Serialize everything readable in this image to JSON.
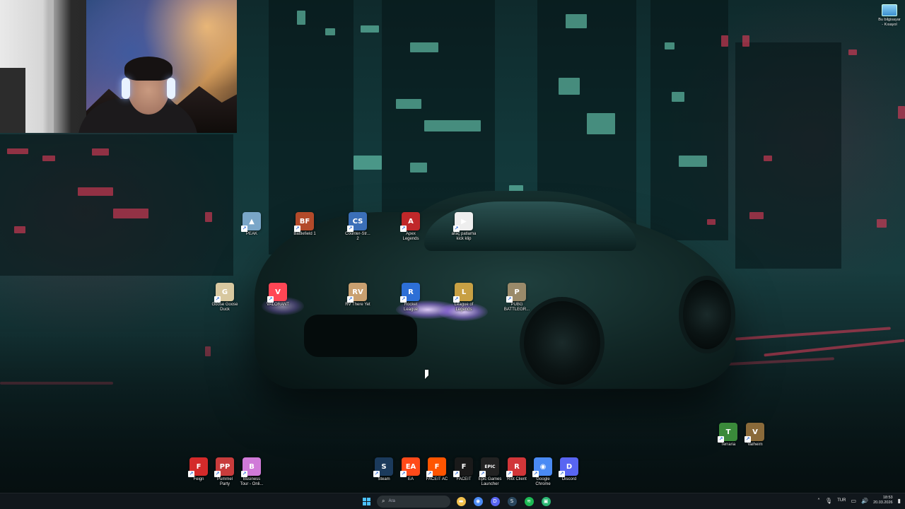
{
  "desktop": {
    "icons_row1": [
      {
        "label": "PEAK",
        "glyph": "▲",
        "color": "#7aa6c8"
      },
      {
        "label": "Battlefield 1",
        "glyph": "BF",
        "color": "#b34a2a"
      },
      {
        "label": "Counter-Str...\n2",
        "glyph": "CS",
        "color": "#3b6fb8"
      },
      {
        "label": "Apex\nLegends",
        "glyph": "A",
        "color": "#c0282a"
      },
      {
        "label": "araç patlama\nkick klip",
        "glyph": "▶",
        "color": "#eeeeee"
      }
    ],
    "icons_row2": [
      {
        "label": "Goose Goose\nDuck",
        "glyph": "G",
        "color": "#d8c8a0"
      },
      {
        "label": "VALORANT",
        "glyph": "V",
        "color": "#ff4655"
      },
      {
        "label": "RV There Yet",
        "glyph": "RV",
        "color": "#c9a070"
      },
      {
        "label": "Rocket\nLeague",
        "glyph": "R",
        "color": "#2d6fd6"
      },
      {
        "label": "League of\nLegends",
        "glyph": "L",
        "color": "#c8a044"
      },
      {
        "label": "PUBG\nBATTLEGR...",
        "glyph": "P",
        "color": "#9a8a6a"
      }
    ],
    "icons_bottom_left": [
      {
        "label": "Feign",
        "glyph": "F",
        "color": "#d42a2a"
      },
      {
        "label": "Pummel\nParty",
        "glyph": "PP",
        "color": "#c83c3c"
      },
      {
        "label": "Business\nTour - Onli...",
        "glyph": "B",
        "color": "#d07ad8"
      }
    ],
    "icons_bottom_mid": [
      {
        "label": "Steam",
        "glyph": "S",
        "color": "#1b3a5c"
      },
      {
        "label": "EA",
        "glyph": "EA",
        "color": "#ff4a1a"
      },
      {
        "label": "FACEIT AC",
        "glyph": "F",
        "color": "#ff5500"
      },
      {
        "label": "FACEIT",
        "glyph": "F",
        "color": "#1a1a1a"
      },
      {
        "label": "Epic Games\nLauncher",
        "glyph": "EPIC",
        "color": "#222222"
      },
      {
        "label": "Riot Client",
        "glyph": "R",
        "color": "#d13639"
      },
      {
        "label": "Google\nChrome",
        "glyph": "◉",
        "color": "#4a8af4"
      },
      {
        "label": "Discord",
        "glyph": "D",
        "color": "#5865f2"
      }
    ],
    "icons_bottom_right": [
      {
        "label": "Terraria",
        "glyph": "T",
        "color": "#3a8a3a"
      },
      {
        "label": "Valheim",
        "glyph": "V",
        "color": "#8a6a3a"
      }
    ],
    "corner_icon": {
      "label": "Bu bilgisayar\n- Kısayol"
    }
  },
  "taskbar": {
    "search_placeholder": "Ara",
    "pinned": [
      {
        "name": "file-explorer",
        "glyph": "▬",
        "color": "#f2c14e"
      },
      {
        "name": "chrome",
        "glyph": "◉",
        "color": "#4a8af4"
      },
      {
        "name": "discord",
        "glyph": "D",
        "color": "#5865f2"
      },
      {
        "name": "steam",
        "glyph": "S",
        "color": "#2a475e"
      },
      {
        "name": "spotify",
        "glyph": "≋",
        "color": "#1db954"
      },
      {
        "name": "app",
        "glyph": "▣",
        "color": "#2bb673"
      }
    ],
    "language": "TUR",
    "time": "18:53",
    "date": "20.03.2026"
  },
  "colors": {
    "accent": "#4cc2ff",
    "taskbar_bg": "#12181c"
  }
}
